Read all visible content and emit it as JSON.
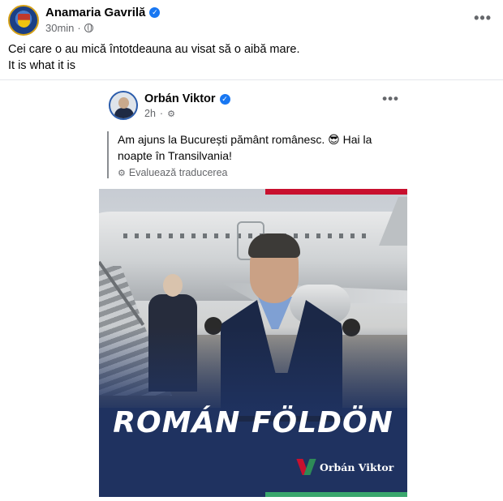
{
  "post": {
    "author": "Anamaria Gavrilă",
    "time": "30min",
    "privacy_icon": "globe-icon",
    "text_line1": "Cei care o au mică întotdeauna au visat să o aibă mare.",
    "text_line2": "It is what it is",
    "more_label": "•••"
  },
  "embedded": {
    "author": "Orbán Viktor",
    "time": "2h",
    "more_label": "•••",
    "text": "Am ajuns la București pământ românesc. 😎 Hai la noapte în Transilvania!",
    "translate_label": "Evaluează traducerea",
    "poster_title": "ROMÁN FÖLDÖN",
    "brand_name": "Orbán Viktor"
  },
  "colors": {
    "verified": "#1877f2",
    "poster_navy": "#1f3260",
    "accent_red": "#c8102e",
    "accent_green": "#3aa76d"
  }
}
